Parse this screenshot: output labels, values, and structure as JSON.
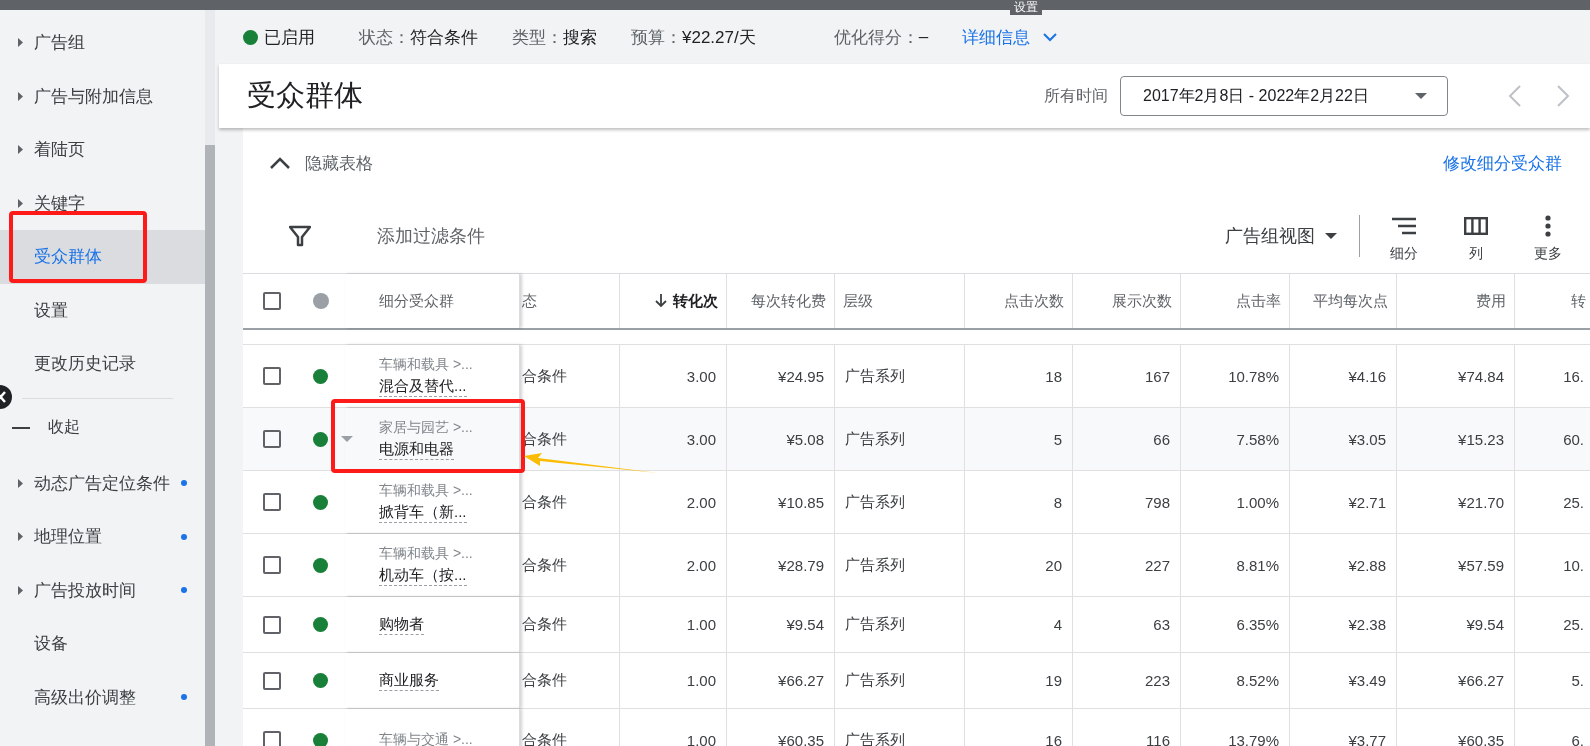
{
  "top_bar": {
    "title": "设置"
  },
  "sidebar": {
    "items": [
      {
        "label": "广告组",
        "expandable": true,
        "selected": false,
        "dot": false
      },
      {
        "label": "广告与附加信息",
        "expandable": true,
        "selected": false,
        "dot": false
      },
      {
        "label": "着陆页",
        "expandable": true,
        "selected": false,
        "dot": false
      },
      {
        "label": "关键字",
        "expandable": true,
        "selected": false,
        "dot": false
      },
      {
        "label": "受众群体",
        "expandable": false,
        "selected": true,
        "dot": false
      },
      {
        "label": "设置",
        "expandable": false,
        "selected": false,
        "dot": false
      },
      {
        "label": "更改历史记录",
        "expandable": false,
        "selected": false,
        "dot": false
      }
    ],
    "collapse_label": "收起",
    "more_items": [
      {
        "label": "动态广告定位条件",
        "expandable": true,
        "selected": false,
        "dot": true
      },
      {
        "label": "地理位置",
        "expandable": true,
        "selected": false,
        "dot": true
      },
      {
        "label": "广告投放时间",
        "expandable": true,
        "selected": false,
        "dot": true
      },
      {
        "label": "设备",
        "expandable": false,
        "selected": false,
        "dot": false
      },
      {
        "label": "高级出价调整",
        "expandable": false,
        "selected": false,
        "dot": true
      }
    ]
  },
  "status_bar": {
    "enabled_label": "已启用",
    "fields": [
      {
        "label": "状态：",
        "value": "符合条件"
      },
      {
        "label": "类型：",
        "value": "搜索"
      },
      {
        "label": "预算：",
        "value": "¥22.27/天"
      }
    ],
    "score_label": "优化得分：",
    "score_value": "–",
    "details_link": "详细信息"
  },
  "header": {
    "title": "受众群体",
    "date_label": "所有时间",
    "date_range": "2017年2月8日 - 2022年2月22日"
  },
  "table_card": {
    "hide_label": "隐藏表格",
    "edit_link": "修改细分受众群",
    "filter_label": "添加过滤条件",
    "view_menu": "广告组视图",
    "tools": [
      {
        "kind": "segment",
        "label": "细分"
      },
      {
        "kind": "columns",
        "label": "列"
      },
      {
        "kind": "more",
        "label": "更多"
      }
    ]
  },
  "table": {
    "header_checked": false,
    "segment_header": "细分受众群",
    "columns": [
      {
        "label": "态",
        "sorted": false
      },
      {
        "label": "转化次",
        "sorted": true
      },
      {
        "label": "每次转化费",
        "sorted": false
      },
      {
        "label": "层级",
        "sorted": false
      },
      {
        "label": "点击次数",
        "sorted": false
      },
      {
        "label": "展示次数",
        "sorted": false
      },
      {
        "label": "点击率",
        "sorted": false
      },
      {
        "label": "平均每次点",
        "sorted": false
      },
      {
        "label": "费用",
        "sorted": false
      },
      {
        "label": "转",
        "sorted": false
      }
    ],
    "rows": [
      {
        "checked": false,
        "hovered": false,
        "category": "车辆和载具 >...",
        "name": "混合及替代...",
        "cells": [
          "合条件",
          "3.00",
          "¥24.95",
          "广告系列",
          "18",
          "167",
          "10.78%",
          "¥4.16",
          "¥74.84",
          "16."
        ]
      },
      {
        "checked": false,
        "hovered": true,
        "category": "家居与园艺 >...",
        "name": "电源和电器",
        "cells": [
          "合条件",
          "3.00",
          "¥5.08",
          "广告系列",
          "5",
          "66",
          "7.58%",
          "¥3.05",
          "¥15.23",
          "60."
        ]
      },
      {
        "checked": false,
        "hovered": false,
        "category": "车辆和载具 >...",
        "name": "掀背车（新...",
        "cells": [
          "合条件",
          "2.00",
          "¥10.85",
          "广告系列",
          "8",
          "798",
          "1.00%",
          "¥2.71",
          "¥21.70",
          "25."
        ]
      },
      {
        "checked": false,
        "hovered": false,
        "category": "车辆和载具 >...",
        "name": "机动车（按...",
        "cells": [
          "合条件",
          "2.00",
          "¥28.79",
          "广告系列",
          "20",
          "227",
          "8.81%",
          "¥2.88",
          "¥57.59",
          "10."
        ]
      },
      {
        "checked": false,
        "hovered": false,
        "name": "购物者",
        "cells": [
          "合条件",
          "1.00",
          "¥9.54",
          "广告系列",
          "4",
          "63",
          "6.35%",
          "¥2.38",
          "¥9.54",
          "25."
        ]
      },
      {
        "checked": false,
        "hovered": false,
        "name": "商业服务",
        "cells": [
          "合条件",
          "1.00",
          "¥66.27",
          "广告系列",
          "19",
          "223",
          "8.52%",
          "¥3.49",
          "¥66.27",
          "5."
        ]
      },
      {
        "checked": false,
        "hovered": false,
        "category": "车辆与交通 >...",
        "cells": [
          "合条件",
          "1.00",
          "¥60.35",
          "广告系列",
          "16",
          "116",
          "13.79%",
          "¥3.77",
          "¥60.35",
          "6."
        ]
      }
    ]
  }
}
